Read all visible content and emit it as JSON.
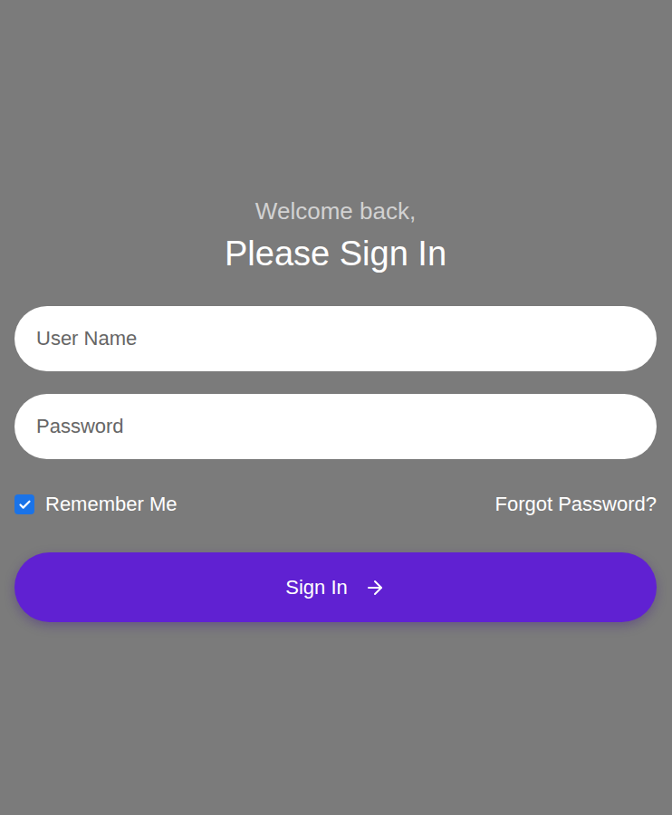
{
  "greeting": "Welcome back,",
  "title": "Please Sign In",
  "fields": [
    {
      "name": "username",
      "placeholder": "User Name",
      "kind": "text"
    },
    {
      "name": "password",
      "placeholder": "Password",
      "kind": "password"
    }
  ],
  "remember": {
    "label": "Remember Me",
    "checked": true
  },
  "forgot_link": "Forgot Password?",
  "submit": {
    "label": "Sign In"
  }
}
